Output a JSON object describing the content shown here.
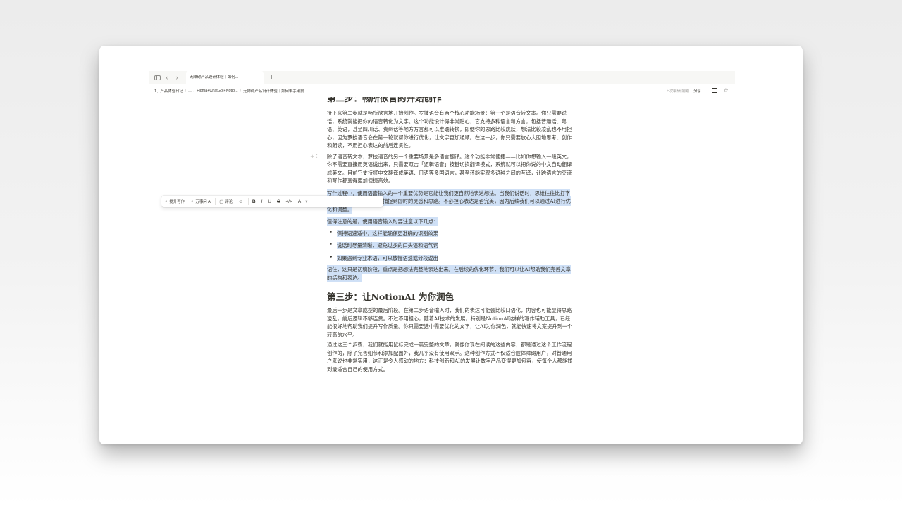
{
  "tabbar": {
    "tab_title": "无障碍产品设计体验｜如何...",
    "add_tab": "+"
  },
  "breadcrumbs": [
    "1、产品体验日记",
    "...",
    "Figma+ChatGpt+Notio...",
    "无障碍产品设计体验｜如何单手用鼠..."
  ],
  "topbar": {
    "edited": "上次编辑 刚刚",
    "share": "分享"
  },
  "content": {
    "step2_heading": "第二步：畅所欲言的开始创作",
    "step2_para1": "接下来第二步就是畅所欲言地开始创作。罗技语音有两个核心功能场景：第一个是语音转文本。你只需要说话，系统就能把你的语音转化为文字。这个功能设计得非常贴心，它支持多种语言和方言，包括普通话、粤语、英语，甚至四川话、贵州话等地方方言都可以准确转换，即便你的思路比较跳跃，想法比较凌乱也不用担心，因为罗技语音会在第一轮就帮你进行优化，让文字更加通顺。在这一步，你只需要放心大胆地思考、创作和朗读，不用担心表达的前后连贯性。",
    "step2_para2": "除了语音转文本，罗技语音的另一个重要场景是多语言翻译。这个功能非常便捷——比如你想输入一段英文，你不需要直接用英语说出来，只需要双击「逻辑语音」按键切换翻译模式，系统就可以把你说的中文自动翻译成英文。目前它支持将中文翻译成英语、日语等多国语言，甚至还能实现多语种之间的互译，让跨语言的交流和写作都变得更加便捷高效。",
    "selected_para1": "写作过程中，使用语音输入的一个重要优势是它能让我们更自然地表达想法。当我们说话时，思维往往比打字时更加流畅，能够更好地捕捉到即时的灵感和思路。不必担心表达是否完美，因为后续我们可以通过AI进行优化和调整。",
    "selected_para2": "值得注意的是，使用语音输入时要注意以下几点：",
    "bullets": [
      "保持语速适中，这样能确保更准确的识别效果",
      "说话时尽量清晰，避免过多的口头语和语气词",
      "如果遇到专业术语，可以放慢语速或分段说出"
    ],
    "selected_para3": "记住，这只是初稿阶段，重点是把想法完整地表达出来。在后续的优化环节，我们可以让AI帮助我们完善文章的结构和表达。",
    "step3_heading": "第三步：让NotionAI 为你润色",
    "step3_para1": "最后一步是文章成型的最后阶段。在第二步语音输入时，我们的表达可能会比较口语化，内容也可能显得思路凌乱，前后逻辑不够连贯。不过不用担心，随着AI技术的发展，特别是NotionAI这样的写作辅助工具，已经能很好地帮助我们提升写作质量。你只需要选中需要优化的文字，让AI为你润色，就能快速将文案提升到一个较高的水平。",
    "step3_para2": "通过这三个步骤，我们就能用鼠标完成一篇完整的文章，就像你现在阅读的这些内容，都是通过这个工作流程创作的，除了完善细节和添加配图外，我几乎没有使用双手。这种创作方式不仅适合肢体障碍用户，对普通用户来说也非常实用，这正是令人感动的地方：科技创新和AI的发展让数字产品变得更加包容，使每个人都能找到最适合自己的使用方式。"
  },
  "toolbar": {
    "improve": "提升写作",
    "ask_ai": "万事问 AI",
    "comment": "评论",
    "bold": "B",
    "italic": "I",
    "underline": "U",
    "strike": "S",
    "code": "</>",
    "color": "A"
  },
  "colors": {
    "selection": "#cfe0f6",
    "text": "#37352f",
    "tabbar_bg": "#f7f7f5"
  }
}
